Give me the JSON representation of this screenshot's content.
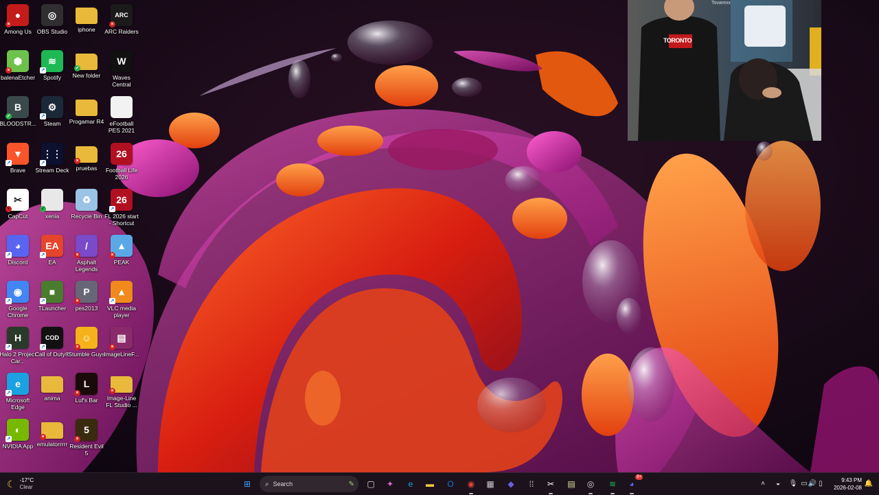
{
  "desktop": {
    "icons": [
      {
        "label": "Among Us",
        "icon": "among-us-icon",
        "color": "#c41b1b",
        "glyph": "●",
        "badge": "err"
      },
      {
        "label": "OBS Studio",
        "icon": "obs-icon",
        "color": "#302e31",
        "glyph": "◎",
        "badge": ""
      },
      {
        "label": "iphone",
        "icon": "folder-icon",
        "color": "#e9b93b",
        "glyph": "",
        "badge": ""
      },
      {
        "label": "ARC Raiders",
        "icon": "arc-raiders-icon",
        "color": "#1b1b1b",
        "glyph": "ARC",
        "badge": "err"
      },
      {
        "label": "balenaEtcher",
        "icon": "balena-etcher-icon",
        "color": "#6cc24a",
        "glyph": "⬢",
        "badge": "err"
      },
      {
        "label": "Spotify",
        "icon": "spotify-icon",
        "color": "#1db954",
        "glyph": "≋",
        "badge": "sc"
      },
      {
        "label": "New folder",
        "icon": "folder-icon",
        "color": "#e9b93b",
        "glyph": "",
        "badge": "ok"
      },
      {
        "label": "Waves Central",
        "icon": "waves-central-icon",
        "color": "#111",
        "glyph": "W",
        "badge": ""
      },
      {
        "label": "BLOODSTR...",
        "icon": "bloodstrike-icon",
        "color": "#3a4a4a",
        "glyph": "B",
        "badge": "ok"
      },
      {
        "label": "Steam",
        "icon": "steam-icon",
        "color": "#1b2838",
        "glyph": "⚙",
        "badge": "sc"
      },
      {
        "label": "Progamar R4",
        "icon": "folder-icon",
        "color": "#e9b93b",
        "glyph": "",
        "badge": ""
      },
      {
        "label": "eFootball PES 2021",
        "icon": "file-icon",
        "color": "#f2f2f2",
        "glyph": "",
        "badge": ""
      },
      {
        "label": "Brave",
        "icon": "brave-icon",
        "color": "#fb542b",
        "glyph": "▼",
        "badge": "sc"
      },
      {
        "label": "Stream Deck",
        "icon": "stream-deck-icon",
        "color": "#0d1130",
        "glyph": "⋮⋮",
        "badge": "sc"
      },
      {
        "label": "pruebas",
        "icon": "folder-icon",
        "color": "#e9b93b",
        "glyph": "",
        "badge": "err"
      },
      {
        "label": "Football Life 2026",
        "icon": "football-life-icon",
        "color": "#b01020",
        "glyph": "26",
        "badge": ""
      },
      {
        "label": "CapCut",
        "icon": "capcut-icon",
        "color": "#fff",
        "glyph": "✂",
        "badge": "err"
      },
      {
        "label": "xenia",
        "icon": "file-icon",
        "color": "#e8e8e8",
        "glyph": "",
        "badge": "ok"
      },
      {
        "label": "Recycle Bin",
        "icon": "recycle-bin-icon",
        "color": "#9ac3e6",
        "glyph": "♻",
        "badge": ""
      },
      {
        "label": "FL 2026 start - Shortcut",
        "icon": "fl-2026-icon",
        "color": "#b01020",
        "glyph": "26",
        "badge": "sc"
      },
      {
        "label": "Discord",
        "icon": "discord-icon",
        "color": "#5865f2",
        "glyph": "◕",
        "badge": "sc"
      },
      {
        "label": "EA",
        "icon": "ea-icon",
        "color": "#e4452b",
        "glyph": "EA",
        "badge": "sc"
      },
      {
        "label": "Asphalt Legends",
        "icon": "asphalt-icon",
        "color": "#7a4ac8",
        "glyph": "/",
        "badge": "err"
      },
      {
        "label": "PEAK",
        "icon": "peak-icon",
        "color": "#5aa9e6",
        "glyph": "▲",
        "badge": "err"
      },
      {
        "label": "Google Chrome",
        "icon": "chrome-icon",
        "color": "#4285f4",
        "glyph": "◉",
        "badge": "sc"
      },
      {
        "label": "TLauncher",
        "icon": "tlauncher-icon",
        "color": "#4a7c2f",
        "glyph": "■",
        "badge": "sc"
      },
      {
        "label": "pes2013",
        "icon": "pes2013-icon",
        "color": "#667",
        "glyph": "P",
        "badge": "err"
      },
      {
        "label": "VLC media player",
        "icon": "vlc-icon",
        "color": "#f08a1c",
        "glyph": "▲",
        "badge": "sc"
      },
      {
        "label": "Halo 2 Project Car...",
        "icon": "halo-icon",
        "color": "#2a3a2a",
        "glyph": "H",
        "badge": "sc"
      },
      {
        "label": "Call of Duty®",
        "icon": "call-of-duty-icon",
        "color": "#111",
        "glyph": "COD",
        "badge": "sc"
      },
      {
        "label": "Stumble Guys",
        "icon": "stumble-guys-icon",
        "color": "#f5b21a",
        "glyph": "☺",
        "badge": "err"
      },
      {
        "label": "ImageLineF...",
        "icon": "winrar-icon",
        "color": "#8a2a6a",
        "glyph": "▤",
        "badge": "err"
      },
      {
        "label": "Microsoft Edge",
        "icon": "edge-icon",
        "color": "#1ba1e2",
        "glyph": "e",
        "badge": "sc"
      },
      {
        "label": "anima",
        "icon": "folder-icon",
        "color": "#e9b93b",
        "glyph": "",
        "badge": ""
      },
      {
        "label": "Luf's Bar",
        "icon": "lufs-bar-icon",
        "color": "#1a0a0a",
        "glyph": "L",
        "badge": "err"
      },
      {
        "label": "Image-Line FL Studio ...",
        "icon": "folder-icon",
        "color": "#e9b93b",
        "glyph": "",
        "badge": "err"
      },
      {
        "label": "NVIDIA App",
        "icon": "nvidia-icon",
        "color": "#76b900",
        "glyph": "◐",
        "badge": "sc"
      },
      {
        "label": "emulatorrrrr",
        "icon": "folder-icon",
        "color": "#e9b93b",
        "glyph": "",
        "badge": "err"
      },
      {
        "label": "Resident Evil 5",
        "icon": "resident-evil-icon",
        "color": "#3a2a10",
        "glyph": "5",
        "badge": "err"
      }
    ]
  },
  "webcam": {
    "overlay_text": "Tovarexx",
    "shirt_text": "TORONTO"
  },
  "taskbar": {
    "weather_temp": "-17°C",
    "weather_desc": "Clear",
    "search_placeholder": "Search",
    "apps": [
      {
        "name": "start-button",
        "glyph": "⊞",
        "color": "#3aa0ff"
      },
      {
        "name": "search-button",
        "glyph": "",
        "color": ""
      },
      {
        "name": "task-view-icon",
        "glyph": "▢",
        "color": "#ddd"
      },
      {
        "name": "copilot-icon",
        "glyph": "✦",
        "color": "#e56bd6"
      },
      {
        "name": "edge-taskbar-icon",
        "glyph": "e",
        "color": "#1ba1e2"
      },
      {
        "name": "file-explorer-icon",
        "glyph": "▬",
        "color": "#f2c744"
      },
      {
        "name": "outlook-icon",
        "glyph": "O",
        "color": "#1b74d4"
      },
      {
        "name": "chrome-taskbar-icon",
        "glyph": "◉",
        "color": "#e94235"
      },
      {
        "name": "microsoft-store-icon",
        "glyph": "▦",
        "color": "#ccc"
      },
      {
        "name": "proton-vpn-icon",
        "glyph": "◆",
        "color": "#6a5ee8"
      },
      {
        "name": "apps-grid-icon",
        "glyph": "⁞⁞",
        "color": "#ddd"
      },
      {
        "name": "capcut-taskbar-icon",
        "glyph": "✂",
        "color": "#fff"
      },
      {
        "name": "notepad-icon",
        "glyph": "▤",
        "color": "#dfe3a0"
      },
      {
        "name": "obs-taskbar-icon",
        "glyph": "◎",
        "color": "#ddd"
      },
      {
        "name": "spotify-taskbar-icon",
        "glyph": "≋",
        "color": "#1db954"
      },
      {
        "name": "discord-taskbar-icon",
        "glyph": "◕",
        "color": "#5865f2"
      }
    ],
    "discord_badge": "9+",
    "tray": [
      {
        "name": "show-hidden-icons",
        "glyph": "˄"
      },
      {
        "name": "tray-app-icon",
        "glyph": "◒"
      },
      {
        "name": "microphone-icon",
        "glyph": "🎙"
      },
      {
        "name": "network-icon",
        "glyph": "▭"
      },
      {
        "name": "volume-icon",
        "glyph": "🔊"
      },
      {
        "name": "battery-icon",
        "glyph": "▯"
      }
    ],
    "time": "9:43 PM",
    "date": "2026-02-08"
  }
}
